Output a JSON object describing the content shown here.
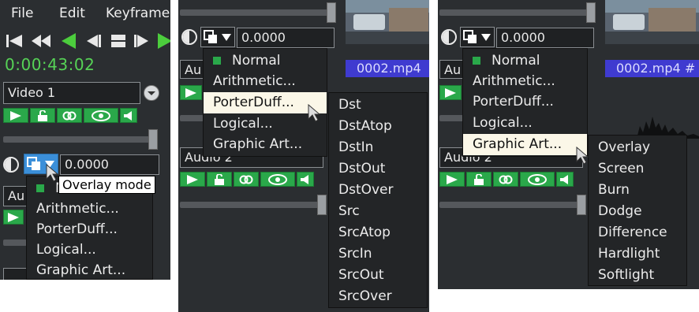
{
  "panel1": {
    "menubar": [
      "File",
      "Edit",
      "Keyframe"
    ],
    "timecode": "0:00:43:02",
    "track_name": "Video 1",
    "fader_value": "0.0000",
    "tooltip": "Overlay mode",
    "audio_track_label": "Au",
    "menu_items": [
      "Normal",
      "Arithmetic...",
      "PorterDuff...",
      "Logical...",
      "Graphic Art..."
    ]
  },
  "panel2": {
    "fader_value": "0.0000",
    "audio_track_1": "Au",
    "audio_track_2": "Audio 2",
    "clip_label": "0002.mp4",
    "menu_items": [
      "Normal",
      "Arithmetic...",
      "PorterDuff...",
      "Logical...",
      "Graphic Art..."
    ],
    "highlighted": "PorterDuff...",
    "submenu_items": [
      "Dst",
      "DstAtop",
      "DstIn",
      "DstOut",
      "DstOver",
      "Src",
      "SrcAtop",
      "SrcIn",
      "SrcOut",
      "SrcOver"
    ]
  },
  "panel3": {
    "fader_value": "0.0000",
    "audio_track_1": "Au",
    "audio_track_2": "Audio 2",
    "clip_label": "0002.mp4 #",
    "menu_items": [
      "Normal",
      "Arithmetic...",
      "PorterDuff...",
      "Logical...",
      "Graphic Art..."
    ],
    "highlighted": "Graphic Art...",
    "submenu_items": [
      "Overlay",
      "Screen",
      "Burn",
      "Dodge",
      "Difference",
      "Hardlight",
      "Softlight"
    ]
  },
  "colors": {
    "panel_bg": "#2b2e31",
    "green": "#2aa84a",
    "timecode": "#56d256",
    "highlight": "#fbf7e8",
    "clip_blue": "#3f3bd0",
    "mode_active": "#3b8fd9"
  }
}
